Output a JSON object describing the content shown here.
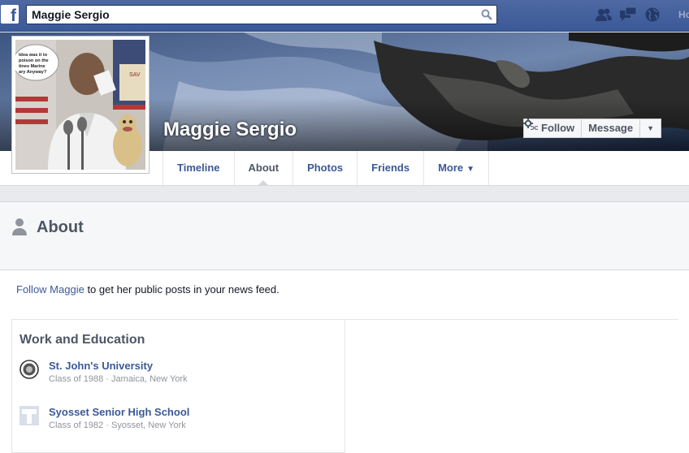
{
  "topbar": {
    "logo": "f",
    "search_value": "Maggie Sergio",
    "home_label": "Ho"
  },
  "profile": {
    "name": "Maggie Sergio",
    "follow_label": "Follow",
    "message_label": "Message",
    "photo_caption_lines": [
      "Idea was it to",
      "poison on the",
      "tines Marine",
      "ary Anyway?"
    ]
  },
  "tabs": [
    {
      "label": "Timeline"
    },
    {
      "label": "About"
    },
    {
      "label": "Photos"
    },
    {
      "label": "Friends"
    },
    {
      "label": "More"
    }
  ],
  "about": {
    "title": "About",
    "follow_link": "Follow Maggie",
    "follow_rest": " to get her public posts in your news feed."
  },
  "work_education": {
    "title": "Work and Education",
    "items": [
      {
        "name": "St. John's University",
        "meta": "Class of 1988 · Jamaica, New York"
      },
      {
        "name": "Syosset Senior High School",
        "meta": "Class of 1982 · Syosset, New York"
      }
    ]
  },
  "colors": {
    "brand": "#3b5998",
    "link": "#3b5998",
    "muted": "#90949c"
  }
}
